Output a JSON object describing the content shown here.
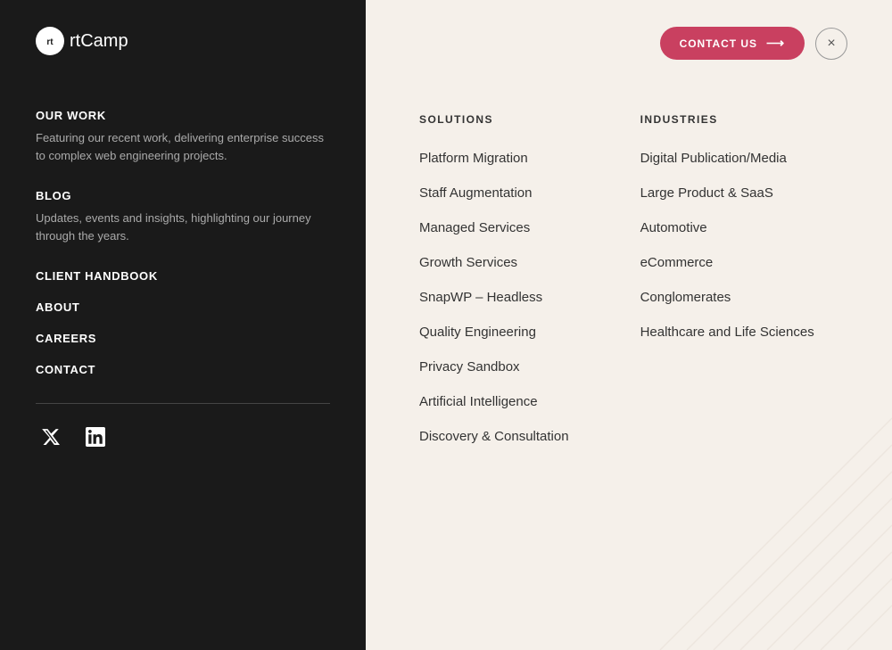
{
  "logo": {
    "icon_text": "rt",
    "name": "Camp",
    "full": "rtCamp"
  },
  "left_panel": {
    "our_work": {
      "title": "OUR WORK",
      "description": "Featuring our recent work, delivering enterprise success to complex web engineering projects."
    },
    "blog": {
      "title": "BLOG",
      "description": "Updates, events and insights, highlighting our journey through the years."
    },
    "client_handbook": {
      "label": "CLIENT HANDBOOK"
    },
    "about": {
      "label": "ABOUT"
    },
    "careers": {
      "label": "CAREERS"
    },
    "contact": {
      "label": "CONTACT"
    }
  },
  "header": {
    "contact_btn_label": "CONTACT US",
    "close_btn_label": "×"
  },
  "solutions": {
    "title": "SOLUTIONS",
    "items": [
      {
        "label": "Platform Migration"
      },
      {
        "label": "Staff Augmentation"
      },
      {
        "label": "Managed Services"
      },
      {
        "label": "Growth Services"
      },
      {
        "label": "SnapWP – Headless"
      },
      {
        "label": "Quality Engineering"
      },
      {
        "label": "Privacy Sandbox"
      },
      {
        "label": "Artificial Intelligence"
      },
      {
        "label": "Discovery & Consultation"
      }
    ]
  },
  "industries": {
    "title": "INDUSTRIES",
    "items": [
      {
        "label": "Digital Publication/Media"
      },
      {
        "label": "Large Product & SaaS"
      },
      {
        "label": "Automotive"
      },
      {
        "label": "eCommerce"
      },
      {
        "label": "Conglomerates"
      },
      {
        "label": "Healthcare and Life Sciences"
      }
    ]
  },
  "colors": {
    "accent": "#c94060",
    "left_bg": "#1a1a1a",
    "right_bg": "#f5f0ea"
  }
}
